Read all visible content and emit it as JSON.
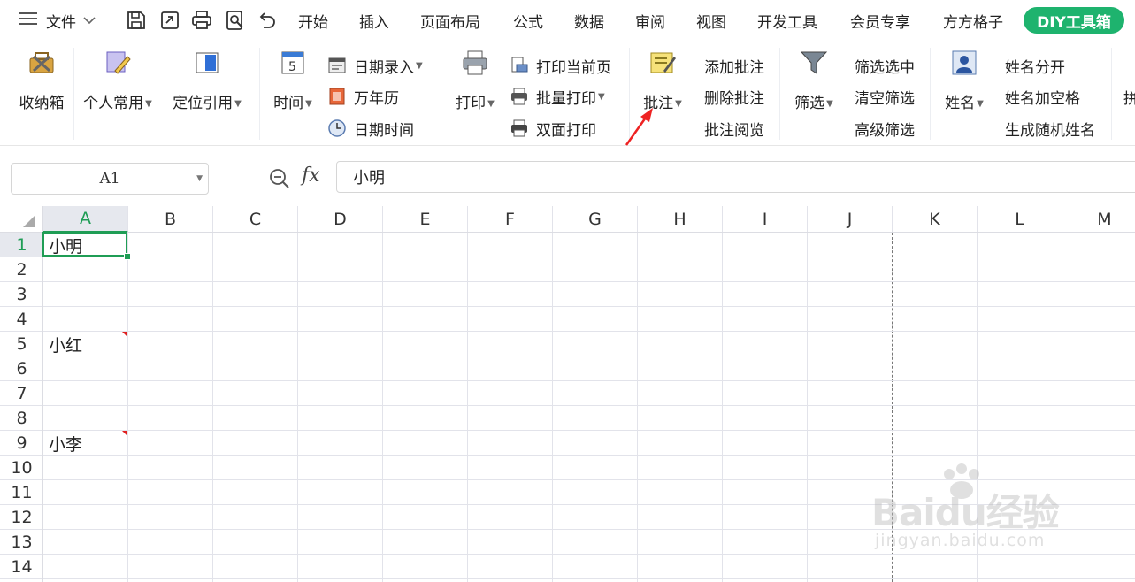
{
  "topbar": {
    "file_label": "文件",
    "tabs": [
      "开始",
      "插入",
      "页面布局",
      "公式",
      "数据",
      "审阅",
      "视图",
      "开发工具",
      "会员专享",
      "方方格子"
    ],
    "active_tab": "DIY工具箱"
  },
  "ribbon": {
    "storage_box": "收纳箱",
    "personal_common": "个人常用",
    "locate_ref": "定位引用",
    "time": "时间",
    "date_entry": "日期录入",
    "perpetual_calendar": "万年历",
    "date_time": "日期时间",
    "print": "打印",
    "print_current_page": "打印当前页",
    "batch_print": "批量打印",
    "duplex_print": "双面打印",
    "comment": "批注",
    "add_comment": "添加批注",
    "delete_comment": "删除批注",
    "browse_comment": "批注阅览",
    "filter": "筛选",
    "filter_selected": "筛选选中",
    "clear_filter": "清空筛选",
    "advanced_filter": "高级筛选",
    "name": "姓名",
    "name_split": "姓名分开",
    "name_add_space": "姓名加空格",
    "random_name": "生成随机姓名",
    "cut_off": "拼"
  },
  "formula_bar": {
    "cell_ref": "A1",
    "fx_label": "fx",
    "content": "小明"
  },
  "sheet": {
    "columns": [
      "A",
      "B",
      "C",
      "D",
      "E",
      "F",
      "G",
      "H",
      "I",
      "J",
      "K",
      "L",
      "M"
    ],
    "rows": [
      "1",
      "2",
      "3",
      "4",
      "5",
      "6",
      "7",
      "8",
      "9",
      "10",
      "11",
      "12",
      "13",
      "14"
    ],
    "cells": {
      "A1": "小明",
      "A5": "小红",
      "A9": "小李"
    }
  },
  "watermark": {
    "brand": "Baidu经验",
    "url": "jingyan.baidu.com"
  },
  "colors": {
    "accent_green": "#1eb36e",
    "selection_green": "#1f9d55",
    "comment_red": "#e02020",
    "arrow_red": "#ee2222"
  }
}
